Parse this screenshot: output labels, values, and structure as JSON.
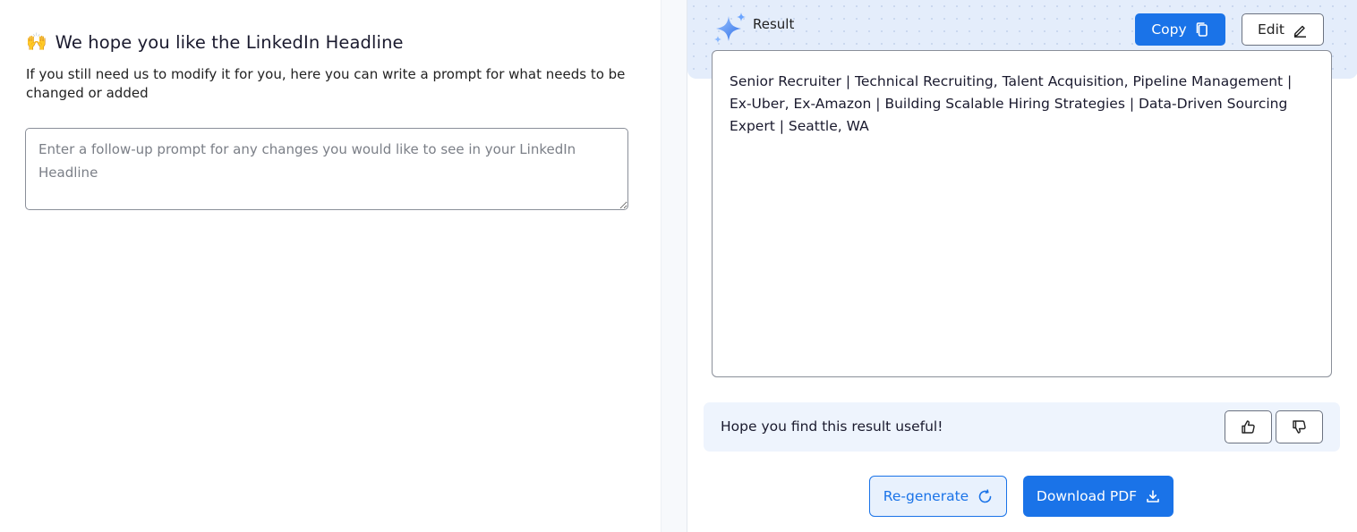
{
  "left_panel": {
    "emoji": "🙌",
    "title": "We hope you like the LinkedIn Headline",
    "subtitle": "If you still need us to modify it for you, here you can write a prompt for what needs to be changed or added",
    "prompt_input": {
      "value": "",
      "placeholder": "Enter a follow-up prompt for any changes you would like to see in your LinkedIn Headline"
    }
  },
  "result_panel": {
    "label": "Result",
    "copy_label": "Copy",
    "edit_label": "Edit",
    "result_text": "Senior Recruiter | Technical Recruiting, Talent Acquisition, Pipeline Management | Ex-Uber, Ex-Amazon | Building Scalable Hiring Strategies | Data-Driven Sourcing Expert | Seattle, WA",
    "feedback_text": "Hope you find this result useful!",
    "regenerate_label": "Re-generate",
    "download_label": "Download PDF"
  },
  "icons": {
    "sparkle": "sparkle-icon",
    "copy": "copy-icon",
    "edit": "pencil-icon",
    "thumbs_up": "thumbs-up-icon",
    "thumbs_down": "thumbs-down-icon",
    "regenerate": "refresh-icon",
    "download": "download-icon"
  },
  "colors": {
    "accent": "#1a73e8",
    "header_bg": "#e4edfb",
    "feedback_bg": "#eef4fd",
    "sparkle_start": "#7fb2ff",
    "sparkle_end": "#2f6fe8"
  }
}
